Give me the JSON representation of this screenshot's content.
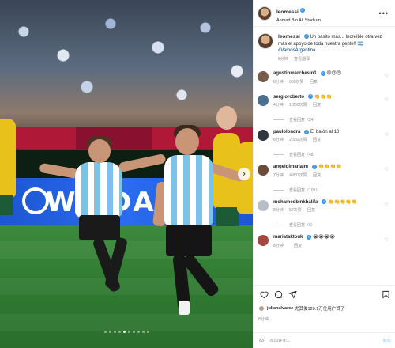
{
  "post": {
    "username": "leomessi",
    "location": "Ahmad Bin Ali Stadium",
    "caption_user": "leomessi",
    "caption_text": "Un pasito más... Increíble otra vez más el apoyo de toda nuestra gente!!",
    "caption_emoji": "🇦🇷",
    "caption_tag": "#VamosArgentina",
    "caption_time": "8分钟",
    "caption_translate": "查看翻译"
  },
  "comments": [
    {
      "user": "agustinmarchesin1",
      "text": "😍😍😍",
      "time": "8分钟",
      "likes": "850次赞",
      "reply": "回复",
      "color": "#7a5c4a",
      "replies": "",
      "heart": "♡"
    },
    {
      "user": "sergioroberto",
      "text": "👏👏👏",
      "time": "4分钟",
      "likes": "1,250次赞",
      "reply": "回复",
      "color": "#4b6f8f",
      "replies": "查看回复（24）",
      "heart": "♡"
    },
    {
      "user": "paulolondra",
      "text": "El baión al 10",
      "time": "8分钟",
      "likes": "2,532次赞",
      "reply": "回复",
      "color": "#2f3640",
      "replies": "查看回复（48）",
      "heart": "♡"
    },
    {
      "user": "angeldimariajm",
      "text": "👏👏👏👏",
      "time": "7分钟",
      "likes": "4,887次赞",
      "reply": "回复",
      "color": "#6b4b3a",
      "replies": "查看回复（109）",
      "heart": "♡"
    },
    {
      "user": "mohamedbinkhalifa",
      "text": "👏👏👏👏👏",
      "time": "8分钟",
      "likes": "57次赞",
      "reply": "回复",
      "color": "#b9bec6",
      "replies": "查看回复（6）",
      "heart": "♡"
    },
    {
      "user": "mariataktouk",
      "text": "😭😭😭😭",
      "time": "8分钟",
      "likes": "",
      "reply": "回复",
      "color": "#a5483f",
      "replies": "",
      "heart": "♡"
    }
  ],
  "likes": {
    "text": "julianalvarez尤其俊120.1万位用户赞了",
    "bold_user": "julianalvarez",
    "rest": "尤其俊120.1万位用户赞了"
  },
  "time_ago": "8分钟",
  "add_comment": {
    "placeholder": "添加评论...",
    "post_label": "发布",
    "emoji_icon": "☺"
  },
  "photo": {
    "ad_text": "WA DA",
    "carousel_total": 10,
    "carousel_active": 4
  },
  "icons": {
    "more": "•••",
    "next": "›",
    "heart": "heart-icon",
    "comment": "comment-icon",
    "share": "share-icon",
    "save": "bookmark-icon"
  },
  "colors": {
    "link": "#00376b",
    "verified": "#3897f0",
    "muted": "#8e8e8e"
  }
}
